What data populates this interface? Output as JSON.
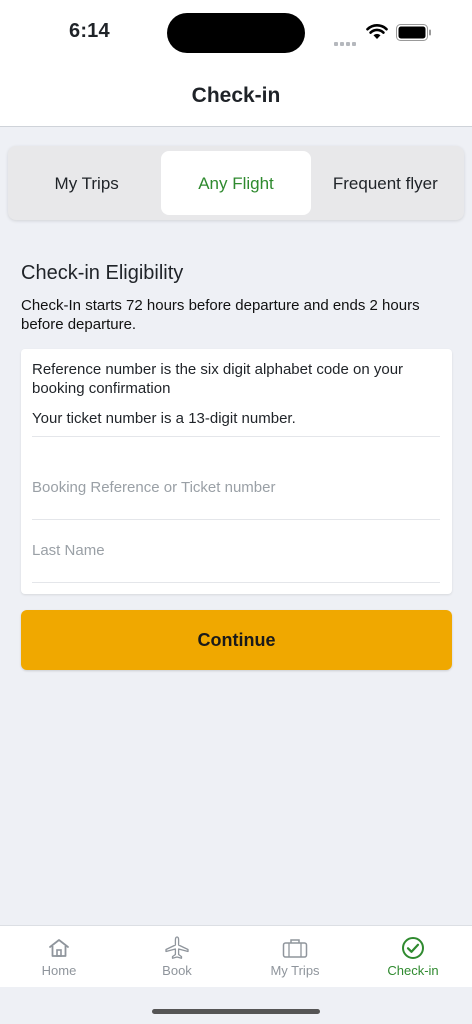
{
  "status_bar": {
    "time": "6:14"
  },
  "header": {
    "title": "Check-in"
  },
  "segments": {
    "items": [
      {
        "label": "My Trips",
        "active": false
      },
      {
        "label": "Any Flight",
        "active": true
      },
      {
        "label": "Frequent flyer",
        "active": false
      }
    ]
  },
  "eligibility": {
    "title": "Check-in Eligibility",
    "description": "Check-In starts 72 hours before departure and ends 2 hours before departure."
  },
  "form": {
    "info_reference": "Reference number is the six digit alphabet code on your booking confirmation",
    "info_ticket": "Your ticket number is a 13-digit number.",
    "booking_ref_placeholder": "Booking Reference or Ticket number",
    "booking_ref_value": "",
    "last_name_placeholder": "Last Name",
    "last_name_value": ""
  },
  "actions": {
    "continue_label": "Continue"
  },
  "tab_bar": {
    "items": [
      {
        "label": "Home",
        "icon": "home-icon",
        "active": false
      },
      {
        "label": "Book",
        "icon": "airplane-icon",
        "active": false
      },
      {
        "label": "My Trips",
        "icon": "briefcase-icon",
        "active": false
      },
      {
        "label": "Check-in",
        "icon": "check-circle-icon",
        "active": true
      }
    ]
  },
  "colors": {
    "accent_green": "#2f8a2f",
    "button_yellow": "#f0a800",
    "background": "#eef0f5"
  }
}
